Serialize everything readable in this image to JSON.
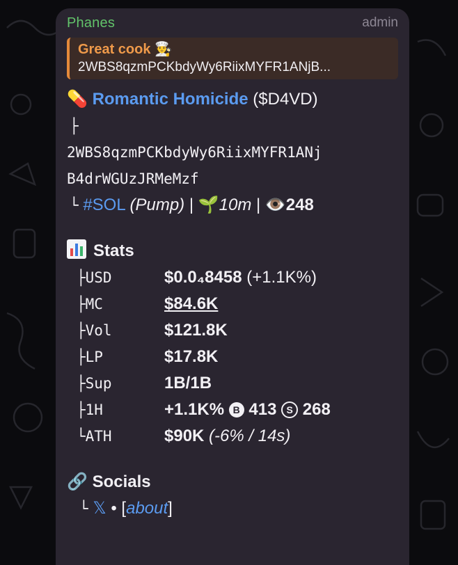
{
  "message": {
    "sender": "Phanes",
    "role": "admin",
    "reply": {
      "title": "Great cook 👨‍🍳",
      "text": "2WBS8qzmPCKbdyWy6RiixMYFR1ANjB..."
    },
    "token": {
      "emoji": "💊",
      "name": "Romantic Homicide",
      "ticker": "($D4VD)",
      "tree_mid": "├",
      "address_line1": "2WBS8qzmPCKbdyWy6RiixMYFR1ANj",
      "address_line2": "B4drWGUzJRMeMzf",
      "tree_end": "└",
      "chain": "#SOL",
      "platform": "(Pump)",
      "sep": "|",
      "age_emoji": "🌱",
      "age": "10m",
      "views_emoji": "👁️",
      "views": "248"
    },
    "stats": {
      "title": "Stats",
      "rows": [
        {
          "key": "├USD",
          "value": "$0.0₄8458",
          "extra": "(+1.1K%)"
        },
        {
          "key": "├MC",
          "value": "$84.6K",
          "extra": ""
        },
        {
          "key": "├Vol",
          "value": "$121.8K",
          "extra": ""
        },
        {
          "key": "├LP",
          "value": "$17.8K",
          "extra": ""
        },
        {
          "key": "├Sup",
          "value": "1B/1B",
          "extra": ""
        },
        {
          "key": "├1H",
          "value": "+1.1K%",
          "buys_icon": "B",
          "buys": "413",
          "sells_icon": "S",
          "sells": "268"
        },
        {
          "key": "└ATH",
          "value": "$90K",
          "extra": "(-6% / 14s)"
        }
      ]
    },
    "socials": {
      "emoji": "🔗",
      "title": "Socials",
      "tree_end": "└",
      "x_label": "𝕏",
      "dot": "•",
      "about_open": "[",
      "about_label": "about",
      "about_close": "]"
    }
  },
  "colors": {
    "bubble": "#2a2530",
    "sender": "#62c36a",
    "link": "#5b9bf0",
    "reply_accent": "#e4893a"
  }
}
